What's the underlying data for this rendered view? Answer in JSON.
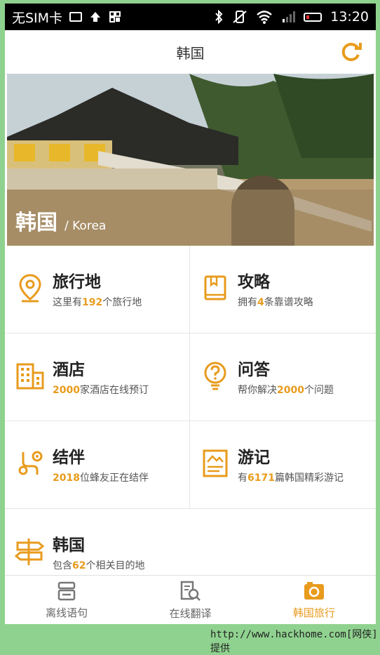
{
  "status_bar": {
    "carrier": "无SIM卡",
    "time": "13:20"
  },
  "header": {
    "title": "韩国",
    "refresh_icon": "refresh-icon"
  },
  "banner": {
    "name_cn": "韩国",
    "name_en": "/ Korea"
  },
  "grid": {
    "destinations": {
      "title": "旅行地",
      "pre": "这里有",
      "num": "192",
      "post": "个旅行地"
    },
    "guides": {
      "title": "攻略",
      "pre": "拥有",
      "num": "4",
      "post": "条靠谱攻略"
    },
    "hotels": {
      "title": "酒店",
      "pre": "",
      "num": "2000",
      "post": "家酒店在线预订"
    },
    "qa": {
      "title": "问答",
      "pre": "帮你解决",
      "num": "2000",
      "post": "个问题"
    },
    "companions": {
      "title": "结伴",
      "pre": "",
      "num": "2018",
      "post": "位蜂友正在结伴"
    },
    "travelogues": {
      "title": "游记",
      "pre": "有",
      "num": "6171",
      "post": "篇韩国精彩游记"
    },
    "country": {
      "title": "韩国",
      "pre": "包含",
      "num": "62",
      "post": "个相关目的地"
    }
  },
  "tabs": [
    {
      "label": "离线语句",
      "icon": "phrasebook-icon",
      "active": false
    },
    {
      "label": "在线翻译",
      "icon": "translate-icon",
      "active": false
    },
    {
      "label": "韩国旅行",
      "icon": "camera-icon",
      "active": true
    }
  ],
  "footer": {
    "text": "http://www.hackhome.com[网侠]提供"
  },
  "colors": {
    "accent": "#e89b1d",
    "background_frame": "#8fd28f"
  }
}
